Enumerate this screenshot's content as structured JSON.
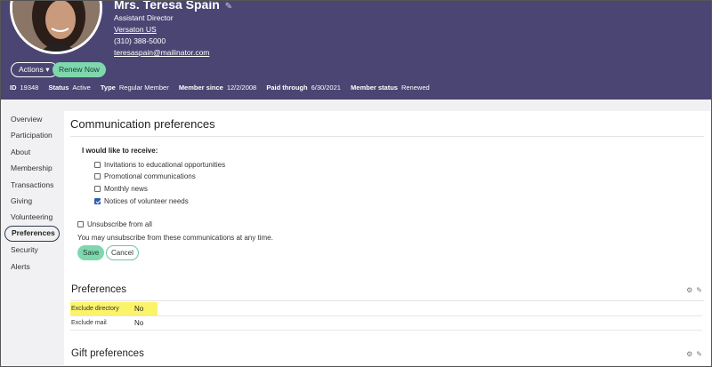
{
  "profile": {
    "name": "Mrs. Teresa Spain",
    "title": "Assistant Director",
    "organization": "Versaton US",
    "phone": "(310) 388-5000",
    "email": "teresaspain@mailinator.com"
  },
  "header_buttons": {
    "actions_label": "Actions ▾",
    "renew_label": "Renew Now"
  },
  "meta": [
    {
      "label": "ID",
      "value": "19348"
    },
    {
      "label": "Status",
      "value": "Active"
    },
    {
      "label": "Type",
      "value": "Regular Member"
    },
    {
      "label": "Member since",
      "value": "12/2/2008"
    },
    {
      "label": "Paid through",
      "value": "6/30/2021"
    },
    {
      "label": "Member status",
      "value": "Renewed"
    }
  ],
  "sidebar": {
    "items": [
      {
        "label": "Overview"
      },
      {
        "label": "Participation"
      },
      {
        "label": "About"
      },
      {
        "label": "Membership"
      },
      {
        "label": "Transactions"
      },
      {
        "label": "Giving"
      },
      {
        "label": "Volunteering"
      },
      {
        "label": "Preferences"
      },
      {
        "label": "Security"
      },
      {
        "label": "Alerts"
      }
    ],
    "active": "Preferences"
  },
  "communication": {
    "heading": "Communication preferences",
    "receive_label": "I would like to receive:",
    "options": [
      {
        "label": "Invitations to educational opportunities",
        "checked": false
      },
      {
        "label": "Promotional communications",
        "checked": false
      },
      {
        "label": "Monthly news",
        "checked": false
      },
      {
        "label": "Notices of volunteer needs",
        "checked": true
      }
    ],
    "unsubscribe_label": "Unsubscribe from all",
    "unsubscribe_note": "You may unsubscribe from these communications at any time.",
    "save_label": "Save",
    "cancel_label": "Cancel"
  },
  "preferences": {
    "heading": "Preferences",
    "rows": [
      {
        "key": "Exclude directory",
        "value": "No",
        "highlighted": true
      },
      {
        "key": "Exclude mail",
        "value": "No",
        "highlighted": false
      }
    ]
  },
  "gift": {
    "heading": "Gift preferences"
  },
  "icons": {
    "gear": "gear-icon",
    "pencil": "pencil-icon"
  },
  "colors": {
    "header_bg": "#4b4573",
    "accent_green": "#7fd7ae",
    "highlight": "#fbf36a"
  }
}
